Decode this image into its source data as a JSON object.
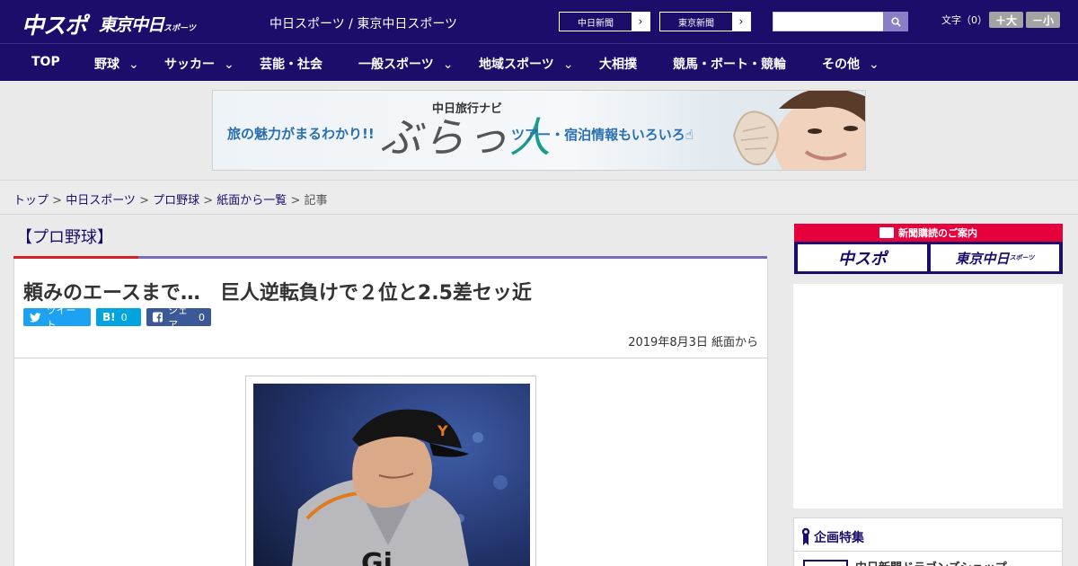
{
  "header": {
    "logo_chuspo": "中スポ",
    "logo_tokyo": "東京中日",
    "logo_tokyo_small": "スポーツ",
    "site_title": "中日スポーツ / 東京中日スポーツ",
    "ext_links": [
      {
        "label": "中日新聞"
      },
      {
        "label": "東京新聞"
      }
    ],
    "search": {
      "value": "",
      "placeholder": ""
    },
    "font_size_label": "文字（0）",
    "font_bigger": "＋大",
    "font_smaller": "－小"
  },
  "nav": {
    "items": [
      {
        "label": "TOP",
        "has_menu": false
      },
      {
        "label": "野球",
        "has_menu": true
      },
      {
        "label": "サッカー",
        "has_menu": true
      },
      {
        "label": "芸能・社会",
        "has_menu": false
      },
      {
        "label": "一般スポーツ",
        "has_menu": true
      },
      {
        "label": "地域スポーツ",
        "has_menu": true
      },
      {
        "label": "大相撲",
        "has_menu": false
      },
      {
        "label": "競馬・ボート・競輪",
        "has_menu": false
      },
      {
        "label": "その他",
        "has_menu": true
      }
    ],
    "chevron": "⌄"
  },
  "ad": {
    "left_text": "旅の魅力がまるわかり!!",
    "brand_small": "中日旅行ナビ",
    "brand_big_1": "ぶらっ",
    "brand_big_2": "人",
    "right_text": "ツアー・宿泊情報もいろいろ☝"
  },
  "breadcrumb": {
    "items": [
      "トップ",
      "中日スポーツ",
      "プロ野球",
      "紙面から一覧"
    ],
    "current": "記事",
    "separator": " > "
  },
  "article": {
    "section": "【プロ野球】",
    "headline": "頼みのエースまで…　巨人逆転負けで２位と2.5差セッ近",
    "share": {
      "tweet_label": "ツイート",
      "hatena_label": "B!",
      "hatena_count": "0",
      "fb_label": "シェア",
      "fb_count": "0"
    },
    "date": "2019年8月3日 紙面から"
  },
  "sidebar": {
    "subscribe_title": "新聞購読のご案内",
    "subscribe_logo_1": "中スポ",
    "subscribe_logo_2": "東京中日",
    "subscribe_logo_2_small": "スポーツ",
    "feature_title": "企画特集",
    "feature_item": "中日新聞ドラゴンズショップ"
  },
  "colors": {
    "brand_navy": "#1c0d6b",
    "accent_red": "#d71f26",
    "accent_purple": "#7d6bb7",
    "twitter": "#1da1f2",
    "hatena": "#00a4de",
    "facebook": "#3b5998"
  }
}
